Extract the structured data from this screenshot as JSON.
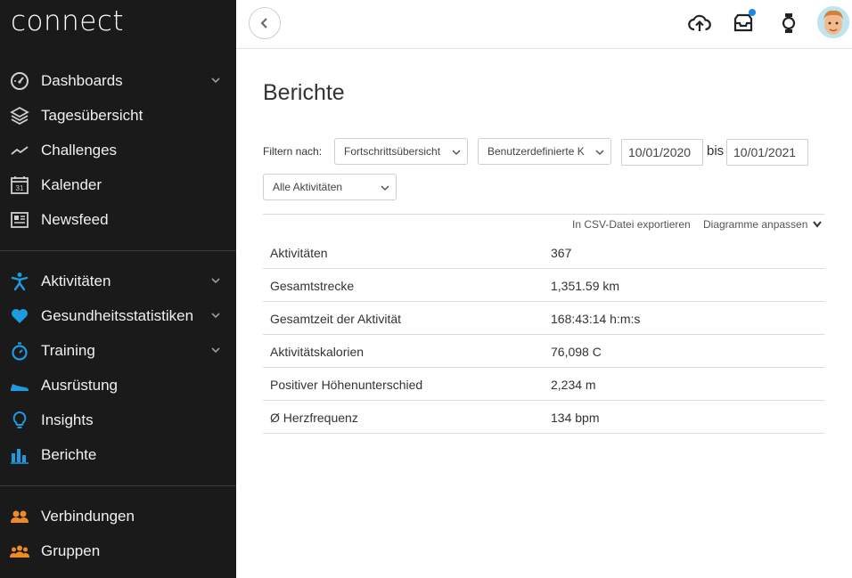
{
  "sidebar": {
    "logo": "connect",
    "group1": [
      {
        "label": "Dashboards",
        "icon": "speedometer-icon",
        "expandable": true
      },
      {
        "label": "Tagesübersicht",
        "icon": "layers-icon",
        "expandable": false
      },
      {
        "label": "Challenges",
        "icon": "trend-line-icon",
        "expandable": false
      },
      {
        "label": "Kalender",
        "icon": "calendar-icon",
        "expandable": false
      },
      {
        "label": "Newsfeed",
        "icon": "newspaper-icon",
        "expandable": false
      }
    ],
    "group2": [
      {
        "label": "Aktivitäten",
        "icon": "running-person-icon",
        "expandable": true
      },
      {
        "label": "Gesundheitsstatistiken",
        "icon": "heart-icon",
        "expandable": true
      },
      {
        "label": "Training",
        "icon": "stopwatch-icon",
        "expandable": true
      },
      {
        "label": "Ausrüstung",
        "icon": "shoe-icon",
        "expandable": false
      },
      {
        "label": "Insights",
        "icon": "lightbulb-icon",
        "expandable": false
      },
      {
        "label": "Berichte",
        "icon": "bar-chart-icon",
        "expandable": false
      }
    ],
    "group3": [
      {
        "label": "Verbindungen",
        "icon": "connections-icon",
        "expandable": false
      },
      {
        "label": "Gruppen",
        "icon": "groups-icon",
        "expandable": false
      }
    ],
    "calendar_day": "31"
  },
  "main": {
    "title": "Berichte",
    "filter_label": "Filtern nach:",
    "report_type": "Fortschrittsübersicht",
    "date_range_type": "Benutzerdefinierte K",
    "date_from": "10/01/2020",
    "date_separator": "bis",
    "date_to": "10/01/2021",
    "activity_filter": "Alle Aktivitäten",
    "export_link": "In CSV-Datei exportieren",
    "customize_link": "Diagramme anpassen",
    "stats": [
      {
        "name": "Aktivitäten",
        "value": "367"
      },
      {
        "name": "Gesamtstrecke",
        "value": "1,351.59 km"
      },
      {
        "name": "Gesamtzeit der Aktivität",
        "value": "168:43:14 h:m:s"
      },
      {
        "name": "Aktivitätskalorien",
        "value": "76,098 C"
      },
      {
        "name": "Positiver Höhenunterschied",
        "value": "2,234 m"
      },
      {
        "name": "Ø Herzfrequenz",
        "value": "134 bpm"
      }
    ]
  },
  "colors": {
    "sidebar_bg": "#1a1a1a",
    "icon_gray": "#cfcfcf",
    "icon_blue": "#1e9be0",
    "icon_orange": "#f08a24",
    "notification_dot": "#1e88e5"
  }
}
